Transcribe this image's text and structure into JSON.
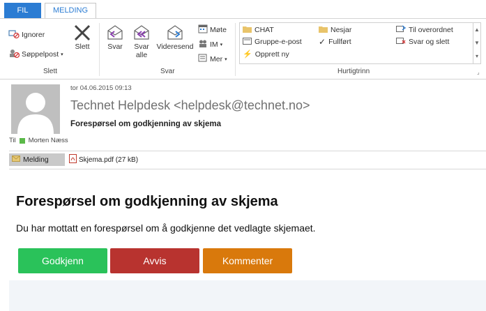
{
  "tabs": {
    "fil": "FIL",
    "melding": "MELDING"
  },
  "ribbon": {
    "slett_group": {
      "ignorer": "Ignorer",
      "soppelpost": "Søppelpost",
      "slett": "Slett",
      "label": "Slett"
    },
    "svar_group": {
      "svar": "Svar",
      "svar_alle_1": "Svar",
      "svar_alle_2": "alle",
      "videresend": "Videresend",
      "mote": "Møte",
      "im": "IM",
      "mer": "Mer",
      "label": "Svar"
    },
    "quicksteps": {
      "chat": "CHAT",
      "gruppe": "Gruppe-e-post",
      "opprett": "Opprett ny",
      "nesjar": "Nesjar",
      "fullfort": "Fullført",
      "til_overordnet": "Til overordnet",
      "svar_og_slett": "Svar og slett",
      "label": "Hurtigtrinn"
    }
  },
  "message": {
    "date": "tor 04.06.2015 09:13",
    "sender": "Technet Helpdesk <helpdesk@technet.no>",
    "subject": "Forespørsel om godkjenning av skjema",
    "to_label": "Til",
    "recipient": "Morten Næss",
    "attachments": {
      "message_tab": "Melding",
      "file": "Skjema.pdf (27 kB)"
    }
  },
  "body": {
    "title": "Forespørsel om godkjenning av skjema",
    "text": "Du har mottatt en forespørsel om å godkjenne det vedlagte skjemaet.",
    "buttons": {
      "approve": "Godkjenn",
      "reject": "Avvis",
      "comment": "Kommenter"
    }
  },
  "colors": {
    "accent": "#2b7cd3",
    "approve": "#2ac25a",
    "reject": "#b8332f",
    "comment": "#d9790c",
    "presence": "#5bb949"
  }
}
